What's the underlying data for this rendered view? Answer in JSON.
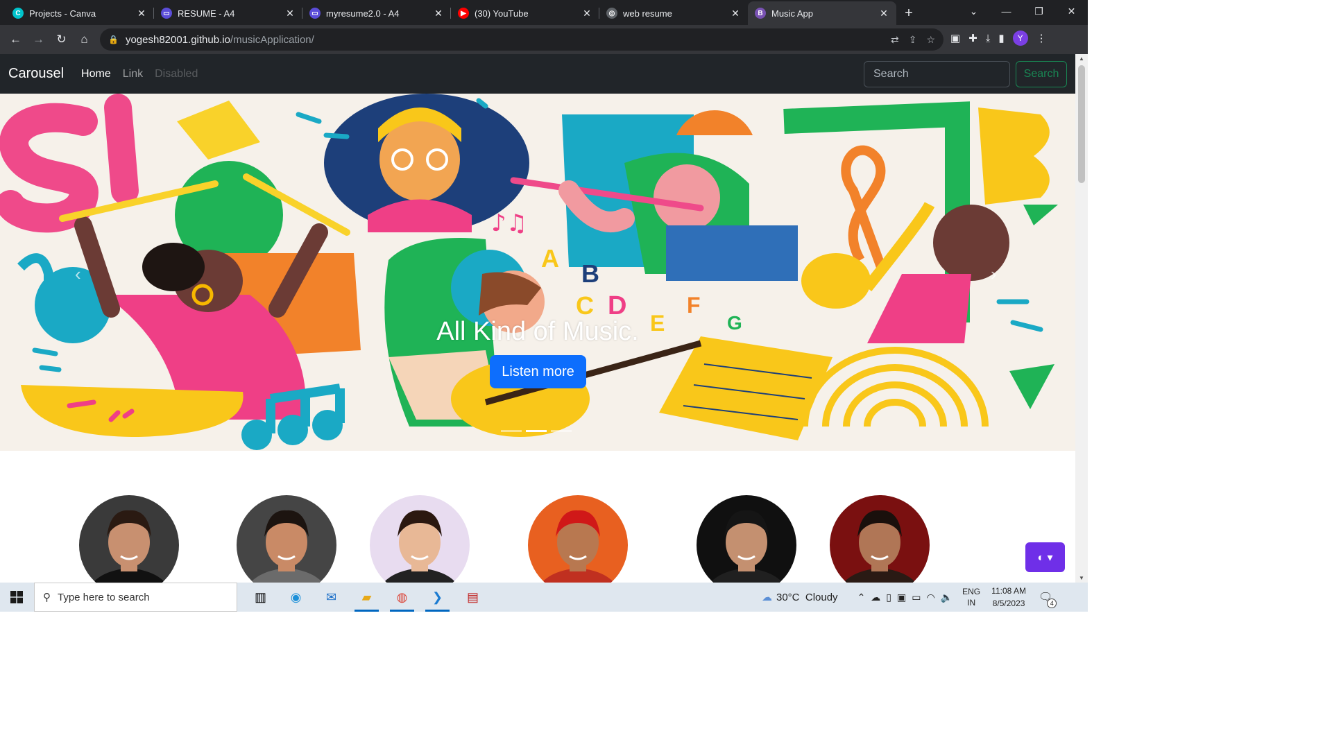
{
  "browser": {
    "tabs": [
      {
        "title": "Projects - Canva",
        "favicon_color": "#00c4cc",
        "favicon_glyph": "C"
      },
      {
        "title": "RESUME - A4",
        "favicon_color": "#5b4dd9",
        "favicon_glyph": "▭"
      },
      {
        "title": "myresume2.0 - A4",
        "favicon_color": "#5b4dd9",
        "favicon_glyph": "▭"
      },
      {
        "title": "(30) YouTube",
        "favicon_color": "#ff0000",
        "favicon_glyph": "▶"
      },
      {
        "title": "web resume",
        "favicon_color": "#5f6368",
        "favicon_glyph": "◎"
      },
      {
        "title": "Music App",
        "favicon_color": "#7952b3",
        "favicon_glyph": "B"
      }
    ],
    "close_glyph": "✕",
    "new_tab_glyph": "+",
    "url_host": "yogesh82001.github.io",
    "url_path": "/musicApplication/",
    "profile_initial": "Y"
  },
  "navbar": {
    "brand": "Carousel",
    "links": [
      {
        "label": "Home",
        "state": "active"
      },
      {
        "label": "Link",
        "state": "normal"
      },
      {
        "label": "Disabled",
        "state": "disabled"
      }
    ],
    "search_placeholder": "Search",
    "search_button": "Search"
  },
  "carousel": {
    "caption": "All Kind of Music.",
    "button": "Listen more",
    "active_indicator": 1,
    "indicator_count": 3
  },
  "artists": [
    {
      "skin": "#c89070",
      "hair": "#2a1a12",
      "bg": "#3a3a3a",
      "shirt": "#111111"
    },
    {
      "skin": "#c98a66",
      "hair": "#1c1410",
      "bg": "#454545",
      "shirt": "#6b6b6b"
    },
    {
      "skin": "#e8b896",
      "hair": "#2b1810",
      "bg": "#e8dcf0",
      "shirt": "#222222"
    },
    {
      "skin": "#b87850",
      "hair": "#d01818",
      "bg": "#e86020",
      "shirt": "#c03020"
    },
    {
      "skin": "#c49070",
      "hair": "#151515",
      "bg": "#101010",
      "shirt": "#202020"
    },
    {
      "skin": "#b07656",
      "hair": "#1a100c",
      "bg": "#7a1010",
      "shirt": "#2a1a14"
    }
  ],
  "theme_toggle": {
    "glyph": "◐ ▾"
  },
  "taskbar": {
    "search_placeholder": "Type here to search",
    "weather_temp": "30°C",
    "weather_desc": "Cloudy",
    "lang_top": "ENG",
    "lang_bottom": "IN",
    "time": "11:08 AM",
    "date": "8/5/2023",
    "notification_count": "4"
  },
  "colors": {
    "accent_blue": "#0d6efd",
    "success_green": "#198754",
    "theme_purple": "#6f2fe8",
    "navbar_dark": "#212529"
  }
}
